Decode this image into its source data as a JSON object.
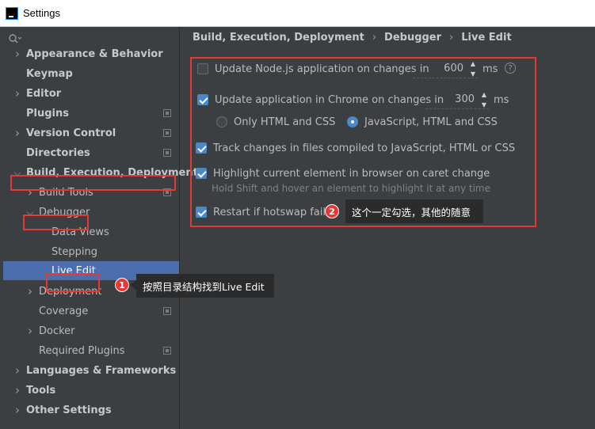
{
  "window": {
    "title": "Settings"
  },
  "search": {
    "icon": "search-icon"
  },
  "breadcrumb": [
    "Build, Execution, Deployment",
    "Debugger",
    "Live Edit"
  ],
  "sidebar": {
    "items": [
      {
        "label": "Appearance & Behavior",
        "bold": true,
        "arrow": "right"
      },
      {
        "label": "Keymap",
        "bold": true
      },
      {
        "label": "Editor",
        "bold": true,
        "arrow": "right"
      },
      {
        "label": "Plugins",
        "bold": true,
        "proj": true
      },
      {
        "label": "Version Control",
        "bold": true,
        "arrow": "right",
        "proj": true
      },
      {
        "label": "Directories",
        "bold": true,
        "proj": true
      },
      {
        "label": "Build, Execution, Deployment",
        "bold": true,
        "arrow": "down"
      },
      {
        "label": "Build Tools",
        "proj": true,
        "arrow": "right"
      },
      {
        "label": "Debugger",
        "arrow": "down"
      },
      {
        "label": "Data Views"
      },
      {
        "label": "Stepping"
      },
      {
        "label": "Live Edit",
        "selected": true
      },
      {
        "label": "Deployment",
        "arrow": "right",
        "proj": true
      },
      {
        "label": "Coverage",
        "proj": true
      },
      {
        "label": "Docker",
        "arrow": "right"
      },
      {
        "label": "Required Plugins",
        "proj": true
      },
      {
        "label": "Languages & Frameworks",
        "bold": true,
        "arrow": "right"
      },
      {
        "label": "Tools",
        "bold": true,
        "arrow": "right"
      },
      {
        "label": "Other Settings",
        "bold": true,
        "arrow": "right"
      }
    ]
  },
  "settings": {
    "node_update": {
      "label": "Update Node.js application on changes in",
      "checked": false,
      "value": "600",
      "unit": "ms"
    },
    "chrome_update": {
      "label": "Update application in Chrome on changes in",
      "checked": true,
      "value": "300",
      "unit": "ms"
    },
    "radio_html": {
      "label": "Only HTML and CSS",
      "selected": false
    },
    "radio_js": {
      "label": "JavaScript, HTML and CSS",
      "selected": true
    },
    "track_changes": {
      "label": "Track changes in files compiled to JavaScript, HTML or CSS",
      "checked": true
    },
    "highlight": {
      "label": "Highlight current element in browser on caret change",
      "checked": true,
      "hint": "Hold Shift and hover an element to highlight it at any time"
    },
    "restart": {
      "label": "Restart if hotswap fails",
      "checked": true
    }
  },
  "annotations": {
    "badge1": "1",
    "callout1": "按照目录结构找到Live Edit",
    "badge2": "2",
    "callout2": "这个一定勾选，其他的随意",
    "accent_color": "#e53935"
  }
}
